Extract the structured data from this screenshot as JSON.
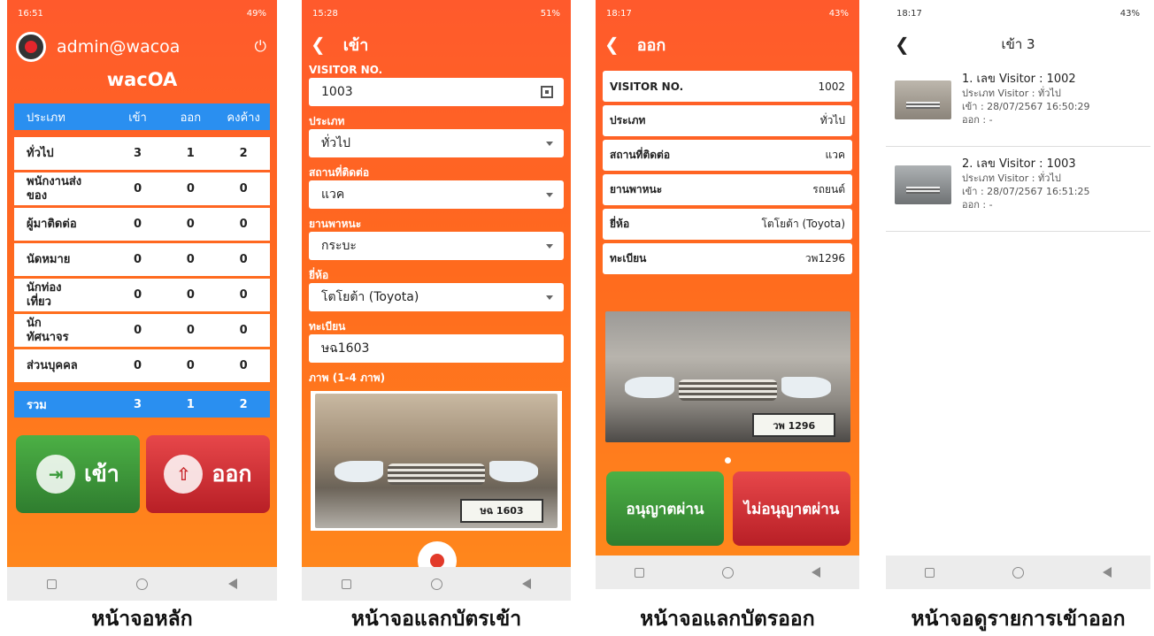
{
  "colors": {
    "orange": "#ff6a1e",
    "table_blue": "#2a8ff0",
    "green": "#3f9e3f",
    "red": "#d1313a"
  },
  "phone1": {
    "status_time": "16:51",
    "status_battery": "49%",
    "user": "admin@wacoa",
    "brand": "wacOA",
    "icons": [
      "power-icon"
    ],
    "headers": [
      "ประเภท",
      "เข้า",
      "ออก",
      "คงค้าง"
    ],
    "rows": [
      {
        "name": "ทั่วไป",
        "in": "3",
        "out": "1",
        "remain": "2"
      },
      {
        "name": "พนักงานส่งของ",
        "in": "0",
        "out": "0",
        "remain": "0"
      },
      {
        "name": "ผู้มาติดต่อ",
        "in": "0",
        "out": "0",
        "remain": "0"
      },
      {
        "name": "นัดหมาย",
        "in": "0",
        "out": "0",
        "remain": "0"
      },
      {
        "name": "นักท่องเที่ยว",
        "in": "0",
        "out": "0",
        "remain": "0"
      },
      {
        "name": "นักทัศนาจร",
        "in": "0",
        "out": "0",
        "remain": "0"
      },
      {
        "name": "ส่วนบุคคล",
        "in": "0",
        "out": "0",
        "remain": "0"
      }
    ],
    "total": {
      "label": "รวม",
      "in": "3",
      "out": "1",
      "remain": "2"
    },
    "btn_in": "เข้า",
    "btn_out": "ออก"
  },
  "phone2": {
    "status_time": "15:28",
    "status_battery": "51%",
    "title": "เข้า",
    "fields": [
      {
        "label": "VISITOR NO.",
        "value": "1003"
      },
      {
        "label": "ประเภท",
        "value": "ทั่วไป"
      },
      {
        "label": "สถานที่ติดต่อ",
        "value": "แวค"
      },
      {
        "label": "ยานพาหนะ",
        "value": "กระบะ"
      },
      {
        "label": "ยี่ห้อ",
        "value": "โตโยต้า (Toyota)"
      },
      {
        "label": "ทะเบียน",
        "value": "ษฉ1603"
      }
    ],
    "photo_label": "ภาพ (1-4 ภาพ)",
    "plate": "ษฉ 1603"
  },
  "phone3": {
    "status_time": "18:17",
    "status_battery": "43%",
    "title": "ออก",
    "rows": [
      {
        "key": "VISITOR NO.",
        "value": "1002"
      },
      {
        "key": "ประเภท",
        "value": "ทั่วไป"
      },
      {
        "key": "สถานที่ติดต่อ",
        "value": "แวค"
      },
      {
        "key": "ยานพาหนะ",
        "value": "รถยนต์"
      },
      {
        "key": "ยี่ห้อ",
        "value": "โตโยต้า (Toyota)"
      },
      {
        "key": "ทะเบียน",
        "value": "วพ1296"
      }
    ],
    "plate": "วพ 1296",
    "btn_allow": "อนุญาตผ่าน",
    "btn_deny": "ไม่อนุญาตผ่าน"
  },
  "phone4": {
    "status_time": "18:17",
    "status_battery": "43%",
    "title": "เข้า 3",
    "items": [
      {
        "title": "1. เลข Visitor : 1002",
        "type": "ประเภท Visitor : ทั่วไป",
        "in": "เข้า : 28/07/2567 16:50:29",
        "out": "ออก : -"
      },
      {
        "title": "2. เลข Visitor : 1003",
        "type": "ประเภท Visitor : ทั่วไป",
        "in": "เข้า : 28/07/2567 16:51:25",
        "out": "ออก : -"
      }
    ]
  },
  "captions": [
    "หน้าจอหลัก",
    "หน้าจอแลกบัตรเข้า",
    "หน้าจอแลกบัตรออก",
    "หน้าจอดูรายการเข้าออก"
  ]
}
